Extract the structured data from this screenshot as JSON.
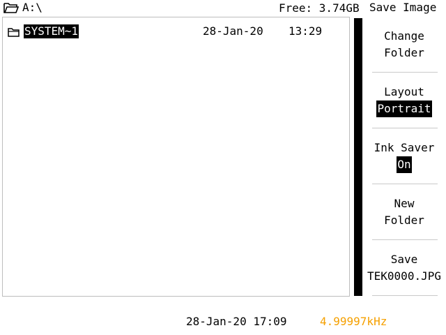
{
  "header": {
    "path": "A:\\",
    "free_space": "Free: 3.74GB",
    "menu_title": "Save Image"
  },
  "files": [
    {
      "name": "SYSTEM~1",
      "date": "28-Jan-20",
      "time": "13:29",
      "icon": "folder-icon",
      "selected": true
    }
  ],
  "softkeys": {
    "change_folder": {
      "line1": "Change",
      "line2": "Folder"
    },
    "layout": {
      "label": "Layout",
      "value": "Portrait"
    },
    "ink_saver": {
      "label": "Ink Saver",
      "value": "On"
    },
    "new_folder": {
      "line1": "New",
      "line2": "Folder"
    },
    "save": {
      "line1": "Save",
      "line2": "TEK0000.JPG"
    }
  },
  "status": {
    "datetime": "28-Jan-20 17:09",
    "frequency": "4.99997kHz",
    "frequency_color": "#f5a000"
  }
}
